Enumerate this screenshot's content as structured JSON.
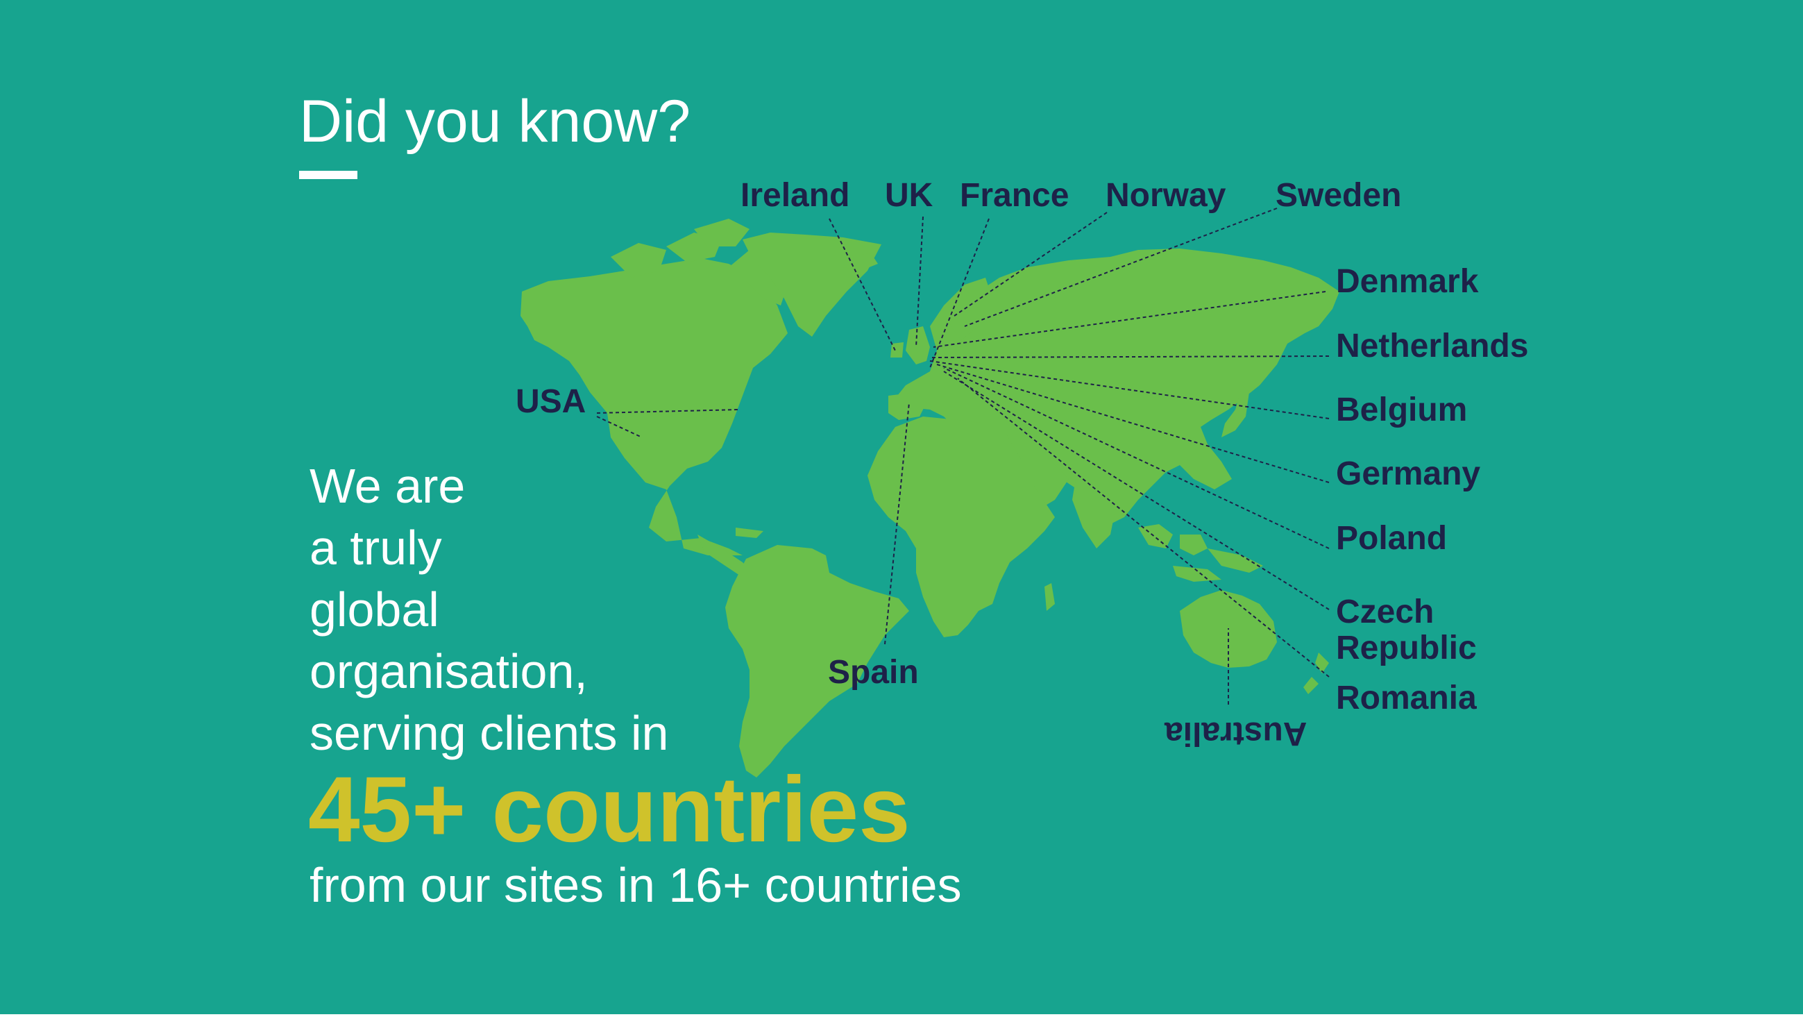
{
  "heading": "Did you know?",
  "intro_lines": [
    "We are",
    "a truly",
    "global",
    "organisation,",
    "serving clients in"
  ],
  "highlight": "45+ countries",
  "subline": "from our sites in 16+ countries",
  "map_labels": {
    "ireland": "Ireland",
    "uk": "UK",
    "france": "France",
    "norway": "Norway",
    "sweden": "Sweden",
    "denmark": "Denmark",
    "netherlands": "Netherlands",
    "belgium": "Belgium",
    "germany": "Germany",
    "poland": "Poland",
    "czech_line1": "Czech",
    "czech_line2": "Republic",
    "romania": "Romania",
    "usa": "USA",
    "spain": "Spain",
    "australia": "Australia"
  },
  "colors": {
    "background": "#17a48f",
    "land": "#6abf4b",
    "highlight": "#cfc22b",
    "label": "#1e2148",
    "text": "#ffffff"
  }
}
